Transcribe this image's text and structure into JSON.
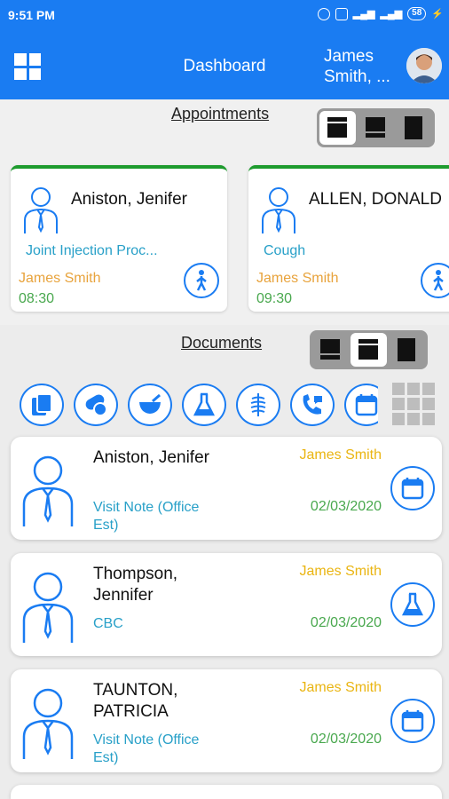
{
  "status_bar": {
    "time": "9:51 PM",
    "battery": "58"
  },
  "header": {
    "title": "Dashboard",
    "user_name": "James Smith, ..."
  },
  "appointments": {
    "title": "Appointments",
    "cards": [
      {
        "patient": "Aniston, Jenifer",
        "reason": "Joint Injection Proc...",
        "provider": "James Smith",
        "time": "08:30"
      },
      {
        "patient": "ALLEN, DONALD",
        "reason": "Cough",
        "provider": "James Smith",
        "time": "09:30"
      }
    ]
  },
  "documents": {
    "title": "Documents",
    "category_icons": [
      "copy-icon",
      "pills-icon",
      "mortar-pestle-icon",
      "lab-flask-icon",
      "xray-icon",
      "phone-icon",
      "calendar-icon"
    ],
    "cards": [
      {
        "patient": "Aniston, Jenifer",
        "type": "Visit Note (Office Est)",
        "author": "James Smith",
        "date": "02/03/2020",
        "icon": "calendar-icon"
      },
      {
        "patient": "Thompson, Jennifer",
        "type": "CBC",
        "author": "James Smith",
        "date": "02/03/2020",
        "icon": "lab-flask-icon"
      },
      {
        "patient": "TAUNTON, PATRICIA",
        "type": "Visit Note (Office Est)",
        "author": "James Smith",
        "date": "02/03/2020",
        "icon": "calendar-icon"
      }
    ]
  },
  "colors": {
    "primary": "#1a7cf2",
    "appointment_border": "#1e9b2e",
    "provider": "#e8a33c",
    "time": "#49a84e",
    "link": "#28a0c8",
    "author": "#eab512"
  }
}
